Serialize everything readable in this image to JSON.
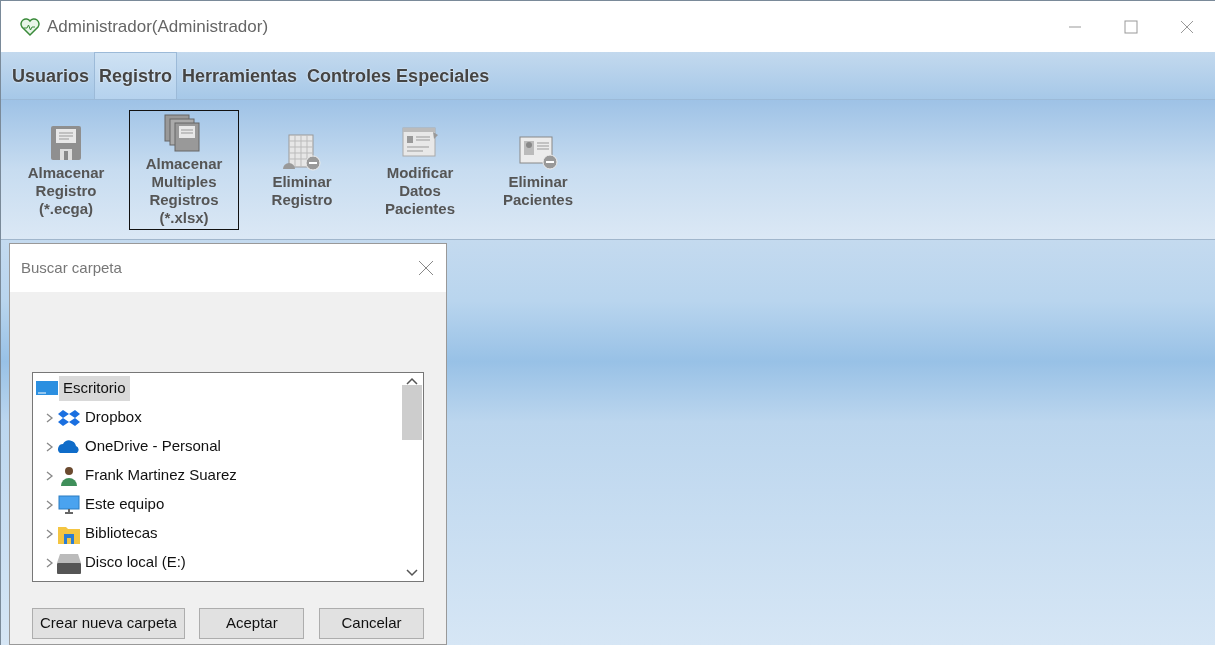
{
  "window": {
    "title": "Administrador(Administrador)"
  },
  "tabs": [
    {
      "label": "Usuarios",
      "selected": false
    },
    {
      "label": "Registro",
      "selected": true
    },
    {
      "label": "Herramientas",
      "selected": false
    },
    {
      "label": "Controles Especiales",
      "selected": false
    }
  ],
  "ribbon": [
    {
      "kind": "floppy",
      "label": "Almacenar\nRegistro\n(*.ecga)",
      "focused": false
    },
    {
      "kind": "floppies",
      "label": "Almacenar\nMultiples\nRegistros\n(*.xlsx)",
      "focused": true
    },
    {
      "kind": "grid-remove",
      "label": "Eliminar\nRegistro",
      "focused": false
    },
    {
      "kind": "form-edit",
      "label": "Modificar\nDatos\nPacientes",
      "focused": false
    },
    {
      "kind": "card-remove",
      "label": "Eliminar\nPacientes",
      "focused": false
    }
  ],
  "dialog": {
    "title": "Buscar carpeta",
    "tree": [
      {
        "kind": "desktop",
        "label": "Escritorio",
        "selected": true,
        "children": [
          {
            "kind": "dropbox",
            "label": "Dropbox",
            "selected": false
          },
          {
            "kind": "cloud",
            "label": "OneDrive - Personal",
            "selected": false
          },
          {
            "kind": "user",
            "label": "Frank Martinez Suarez",
            "selected": false
          },
          {
            "kind": "computer",
            "label": "Este equipo",
            "selected": false
          },
          {
            "kind": "library",
            "label": "Bibliotecas",
            "selected": false
          },
          {
            "kind": "drive",
            "label": "Disco local (E:)",
            "selected": false
          }
        ]
      }
    ],
    "buttons": [
      "Crear nueva carpeta",
      "Aceptar",
      "Cancelar"
    ]
  }
}
